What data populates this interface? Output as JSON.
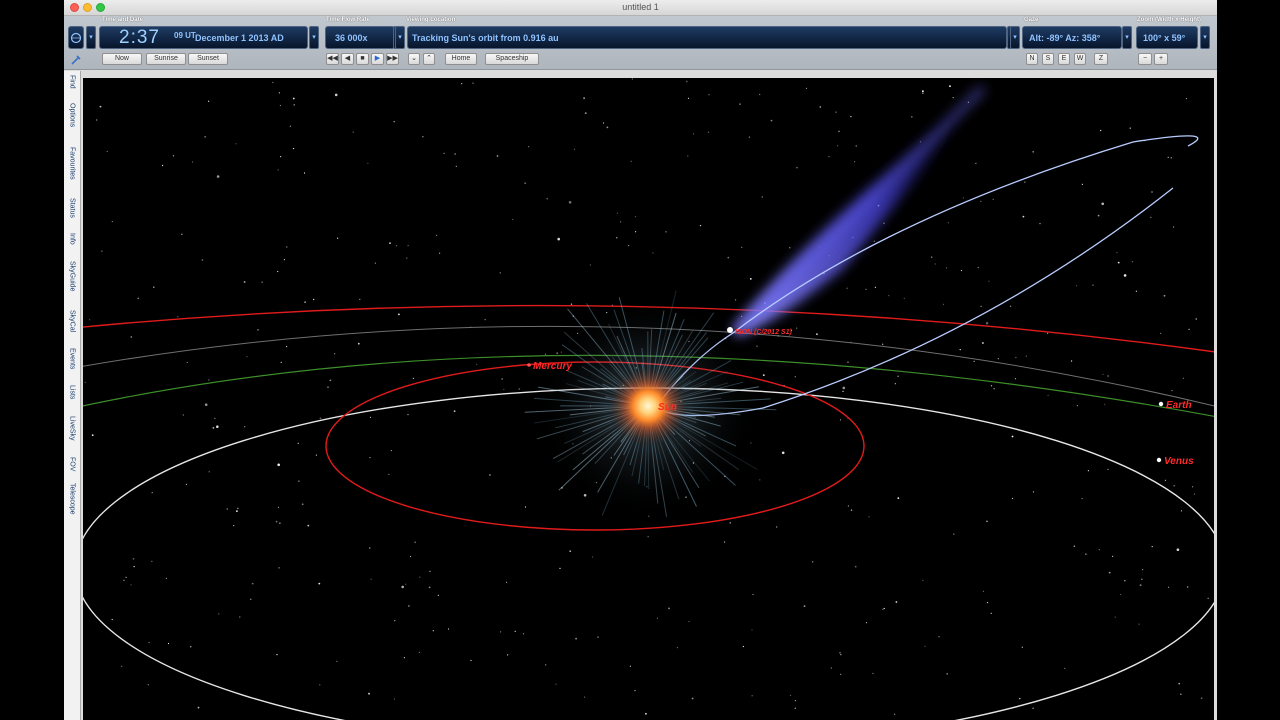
{
  "window": {
    "title": "untitled 1"
  },
  "toolbar": {
    "time_group": {
      "label": "Time and Date",
      "time": "2:37",
      "seconds_zone": "09 UT",
      "date": "December   1   2013 AD",
      "now_label": "Now",
      "sunrise_label": "Sunrise",
      "sunset_label": "Sunset"
    },
    "flow_group": {
      "label": "Time Flow Rate",
      "rate": "36 000x"
    },
    "location_group": {
      "label": "Viewing Location",
      "text": "Tracking Sun's orbit from 0.916 au",
      "home_label": "Home",
      "spaceship_label": "Spaceship"
    },
    "gaze_group": {
      "label": "Gaze",
      "text": "Alt: -89° Az: 358°",
      "dirs": [
        "N",
        "S",
        "E",
        "W",
        "Z"
      ]
    },
    "zoom_group": {
      "label": "Zoom (Width x Height)",
      "text": "100° x 59°",
      "minus": "−",
      "plus": "+"
    }
  },
  "sidebar": {
    "tabs": [
      "Find",
      "Options",
      "Favourites",
      "Status",
      "Info",
      "SkyGuide",
      "SkyCal",
      "Events",
      "Lists",
      "LiveSky",
      "FOV",
      "Telescope"
    ]
  },
  "sky": {
    "labels": {
      "comet": "ISON (C/2012 S1)",
      "sun": "Sun",
      "mercury": "Mercury",
      "earth": "Earth",
      "venus": "Venus"
    },
    "colors": {
      "label_red": "#ff2a2a",
      "orbit_red": "#e11b1b",
      "orbit_white": "#e6e6e6",
      "orbit_green": "#3d8f2a",
      "comet_orbit": "#b8ccff",
      "comet_tail": "#5a56ff"
    }
  }
}
